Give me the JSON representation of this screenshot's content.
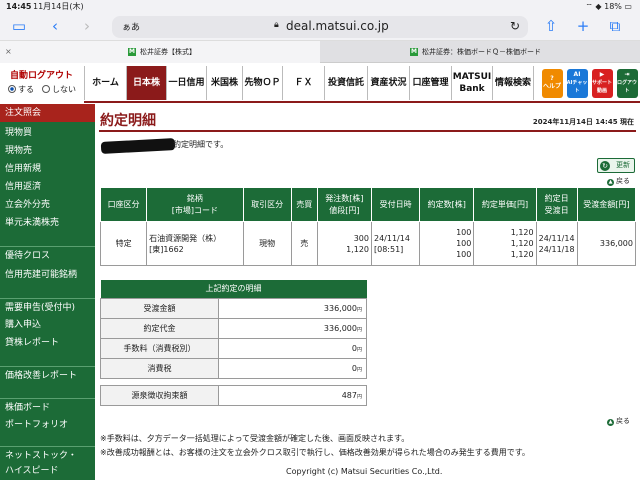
{
  "status": {
    "time": "14:45",
    "date": "11月14日(木)",
    "battery": "18%"
  },
  "browser": {
    "url_prefix": "ぁあ",
    "host": "deal.matsui.co.jp",
    "tabs": [
      {
        "label": "松井証券【株式】",
        "fav": "M"
      },
      {
        "label": "松井証券：株価ボードＱ－株価ボード",
        "fav": "M"
      }
    ]
  },
  "login": {
    "logout": "自動ログアウト",
    "on": "する",
    "off": "しない"
  },
  "nav": [
    {
      "label": "ホーム"
    },
    {
      "label": "日本株"
    },
    {
      "label": "一日信用"
    },
    {
      "label": "米国株"
    },
    {
      "label": "先物ＯＰ"
    },
    {
      "label": "ＦＸ"
    },
    {
      "label": "投資信託"
    },
    {
      "label": "資産状況"
    },
    {
      "label": "口座管理"
    },
    {
      "label": "MATSUI Bank"
    },
    {
      "label": "情報検索"
    }
  ],
  "nav_icons": [
    {
      "label": "ヘルプ",
      "glyph": "?",
      "color": "#f08a00"
    },
    {
      "label": "AIチャット",
      "glyph": "AI",
      "color": "#1a78d8"
    },
    {
      "label": "サポート動画",
      "glyph": "▶",
      "color": "#d82020"
    },
    {
      "label": "ログアウト",
      "glyph": "⇥",
      "color": "#1c6b37"
    }
  ],
  "sidebar": [
    {
      "label": "注文照会"
    },
    {
      "label": "現物買"
    },
    {
      "label": "現物売"
    },
    {
      "label": "信用新規"
    },
    {
      "label": "信用返済"
    },
    {
      "label": "立会外分売"
    },
    {
      "label": "単元未満株売"
    },
    {
      "label": "優待クロス"
    },
    {
      "label": "信用売建可能銘柄"
    },
    {
      "label": "需要申告(受付中)"
    },
    {
      "label": "購入申込"
    },
    {
      "label": "貸株レポート"
    },
    {
      "label": "価格改善レポート"
    },
    {
      "label": "株価ボード"
    },
    {
      "label": "ポートフォリオ"
    },
    {
      "label": "ネットストック・"
    },
    {
      "label": "ハイスピード"
    }
  ],
  "page": {
    "title": "約定明細",
    "timestamp": "2024年11月14日 14:45 現在",
    "message": "約定明細です。",
    "refresh": "更新",
    "back": "戻る"
  },
  "orders": {
    "headers": [
      "口座区分",
      "銘柄\n[市場]コード",
      "取引区分",
      "売買",
      "発注数[株]\n値段[円]",
      "受付日時",
      "約定数[株]",
      "約定単価[円]",
      "約定日\n受渡日",
      "受渡金額[円]"
    ],
    "row": {
      "account": "特定",
      "stock": "石油資源開発（株）",
      "market": "[東]1662",
      "trade": "現物",
      "side": "売",
      "qty": "300",
      "price": "1,120",
      "recv_date": "24/11/14",
      "recv_time": "[08:51]",
      "exec_qty": [
        "100",
        "100",
        "100"
      ],
      "exec_price": [
        "1,120",
        "1,120",
        "1,120"
      ],
      "exec_date": "24/11/14",
      "settle_date": "24/11/18",
      "amount": "336,000"
    }
  },
  "summary": {
    "title": "上記約定の明細",
    "unit": "円",
    "rows": [
      {
        "label": "受渡金額",
        "value": "336,000"
      },
      {
        "label": "約定代金",
        "value": "336,000"
      },
      {
        "label": "手数料（消費税別）",
        "value": "0"
      },
      {
        "label": "消費税",
        "value": "0"
      },
      {
        "label": "源泉徴収拘束額",
        "value": "487"
      }
    ]
  },
  "notes": [
    "※手数料は、夕方データ一括処理によって受渡金額が確定した後、画面反映されます。",
    "※改善成功報酬とは、お客様の注文を立会外クロス取引で執行し、価格改善効果が得られた場合のみ発生する費用です。"
  ],
  "footer": "Copyright (c) Matsui Securities Co.,Ltd."
}
